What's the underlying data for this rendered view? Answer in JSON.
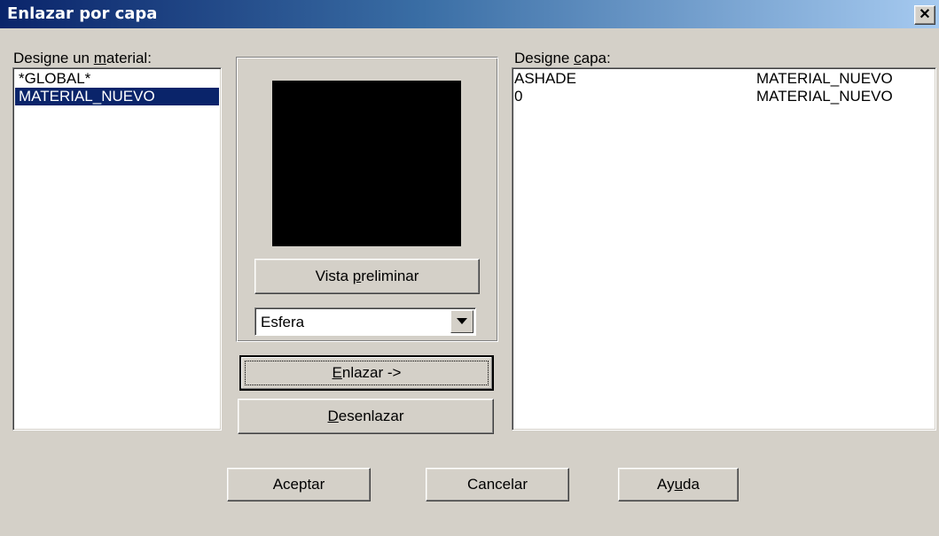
{
  "window": {
    "title": "Enlazar por capa",
    "close_glyph": "✕"
  },
  "materials": {
    "label_pre": "Designe un ",
    "label_u": "m",
    "label_post": "aterial:",
    "items": [
      {
        "label": "*GLOBAL*",
        "selected": false
      },
      {
        "label": "MATERIAL_NUEVO",
        "selected": true
      }
    ]
  },
  "preview": {
    "button_pre": "Vista ",
    "button_u": "p",
    "button_post": "reliminar",
    "shape_value": "Esfera",
    "arrow_icon": "chevron-down-icon"
  },
  "actions": {
    "link_u": "E",
    "link_post": "nlazar ->",
    "unlink_u": "D",
    "unlink_post": "esenlazar"
  },
  "layers": {
    "label_pre": "Designe ",
    "label_u": "c",
    "label_post": "apa:",
    "rows": [
      {
        "layer": "ASHADE",
        "material": "MATERIAL_NUEVO"
      },
      {
        "layer": "0",
        "material": "MATERIAL_NUEVO"
      }
    ]
  },
  "footer": {
    "accept": "Aceptar",
    "cancel": "Cancelar",
    "help_pre": "Ay",
    "help_u": "u",
    "help_post": "da"
  },
  "colors": {
    "dialog_bg": "#d4d0c8",
    "selection": "#0a246a",
    "title_start": "#0a246a",
    "title_end": "#a6caf0"
  }
}
